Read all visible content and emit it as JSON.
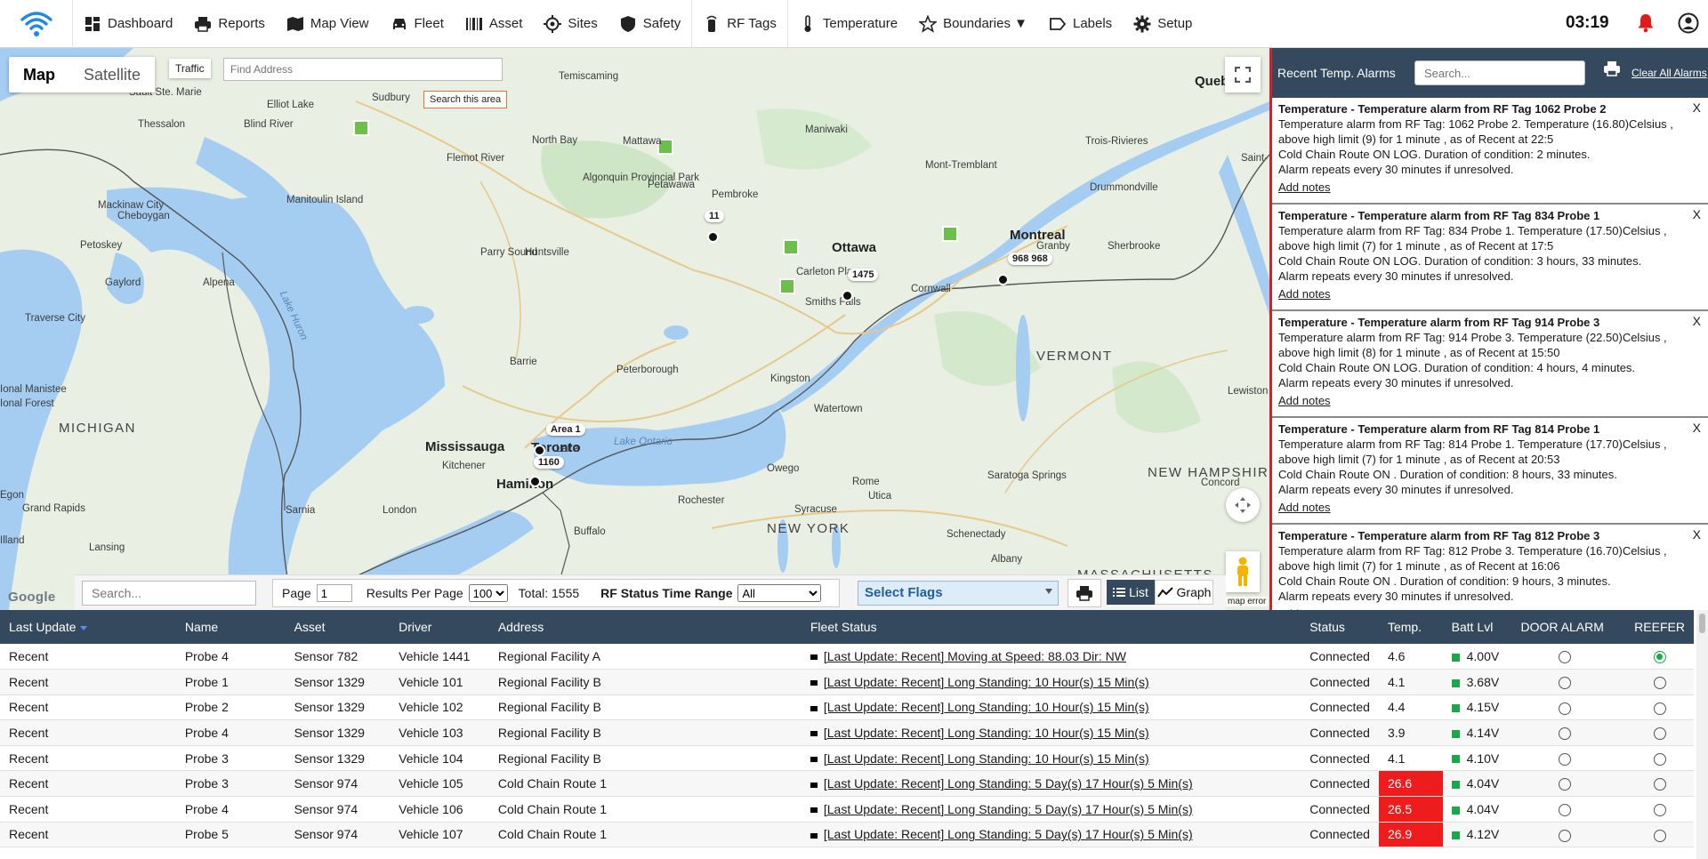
{
  "nav": {
    "items": [
      {
        "label": "Dashboard",
        "icon": "dashboard-icon"
      },
      {
        "label": "Reports",
        "icon": "printer-icon"
      },
      {
        "label": "Map View",
        "icon": "map-icon"
      },
      {
        "label": "Fleet",
        "icon": "car-icon"
      },
      {
        "label": "Asset",
        "icon": "barcode-icon"
      },
      {
        "label": "Sites",
        "icon": "crosshair-icon"
      },
      {
        "label": "Safety",
        "icon": "shield-icon"
      },
      {
        "label": "RF Tags",
        "icon": "rf-tag-icon"
      },
      {
        "label": "Temperature",
        "icon": "thermometer-icon"
      },
      {
        "label": "Boundaries ▼",
        "icon": "star-icon"
      },
      {
        "label": "Labels",
        "icon": "tag-icon"
      },
      {
        "label": "Setup",
        "icon": "gear-icon"
      }
    ],
    "time": "03:19"
  },
  "map": {
    "type_map": "Map",
    "type_satellite": "Satellite",
    "traffic": "Traffic",
    "find_placeholder": "Find Address",
    "search_area": "Search this area",
    "map_error": "map error",
    "google": "Google",
    "places": [
      {
        "name": "Temiscaming"
      },
      {
        "name": "Sault Ste. Marie"
      },
      {
        "name": "Elliot Lake"
      },
      {
        "name": "Sudbury"
      },
      {
        "name": "Thessalon"
      },
      {
        "name": "Blind River"
      },
      {
        "name": "North Bay"
      },
      {
        "name": "Mattawa"
      },
      {
        "name": "Maniwaki"
      },
      {
        "name": "Trois-Rivieres"
      },
      {
        "name": "Mont-Tremblant"
      },
      {
        "name": "Drummondville"
      },
      {
        "name": "Flemot River"
      },
      {
        "name": "Algonquin Provincial Park"
      },
      {
        "name": "Petawawa"
      },
      {
        "name": "Pembroke"
      },
      {
        "name": "Mackinaw City"
      },
      {
        "name": "Cheboygan"
      },
      {
        "name": "Manitoulin Island"
      },
      {
        "name": "Ottawa"
      },
      {
        "name": "Montreal"
      },
      {
        "name": "Granby"
      },
      {
        "name": "Sherbrooke"
      },
      {
        "name": "Petoskey"
      },
      {
        "name": "Parry Sound"
      },
      {
        "name": "Huntsville"
      },
      {
        "name": "Carleton Place"
      },
      {
        "name": "Cornwall"
      },
      {
        "name": "Gaylord"
      },
      {
        "name": "Alpena"
      },
      {
        "name": "Smiths Falls"
      },
      {
        "name": "Traverse City"
      },
      {
        "name": "Barrie"
      },
      {
        "name": "Peterborough"
      },
      {
        "name": "VERMONT"
      },
      {
        "name": "Kingston"
      },
      {
        "name": "Lewiston"
      },
      {
        "name": "MICHIGAN"
      },
      {
        "name": "Mississauga"
      },
      {
        "name": "Toronto"
      },
      {
        "name": "Watertown"
      },
      {
        "name": "Kitchener"
      },
      {
        "name": "Lake Ontario"
      },
      {
        "name": "Hamilton"
      },
      {
        "name": "Owego"
      },
      {
        "name": "NEW HAMPSHIRE"
      },
      {
        "name": "Concord"
      },
      {
        "name": "Rome"
      },
      {
        "name": "Utica"
      },
      {
        "name": "Rochester"
      },
      {
        "name": "Syracuse"
      },
      {
        "name": "Saratoga Springs"
      },
      {
        "name": "Grand Rapids"
      },
      {
        "name": "Sarnia"
      },
      {
        "name": "London"
      },
      {
        "name": "Buffalo"
      },
      {
        "name": "NEW YORK"
      },
      {
        "name": "Schenectady"
      },
      {
        "name": "Lansing"
      },
      {
        "name": "Albany"
      },
      {
        "name": "MASSACHUSETTS"
      },
      {
        "name": "Lake Huron"
      },
      {
        "name": "Queb"
      },
      {
        "name": "Saint-"
      },
      {
        "name": "Lake"
      },
      {
        "name": "Ional Manistee"
      },
      {
        "name": "Ional Forest"
      },
      {
        "name": "Illand"
      },
      {
        "name": "Egon"
      }
    ],
    "markers": [
      {
        "label": "11"
      },
      {
        "label": "1475"
      },
      {
        "label": "968 968"
      },
      {
        "label": "Area 1"
      },
      {
        "label": "1160"
      }
    ]
  },
  "filter": {
    "search_placeholder": "Search...",
    "page_label": "Page",
    "page_value": "1",
    "results_label": "Results Per Page",
    "results_value": "100",
    "total": "Total: 1555",
    "range_label": "RF Status Time Range",
    "range_value": "All",
    "flags": "Select Flags",
    "list": "List",
    "graph": "Graph"
  },
  "alarms": {
    "title": "Recent Temp. Alarms",
    "search_placeholder": "Search...",
    "clear": "Clear All Alarms",
    "add_notes": "Add notes",
    "items": [
      {
        "title": "Temperature - Temperature alarm from RF Tag 1062 Probe 2",
        "l1": "Temperature alarm from RF Tag: 1062 Probe 2. Temperature (16.80)Celsius ,",
        "l2": "above high limit (9) for 1 minute , as of Recent at 22:5",
        "l3": "Cold Chain Route ON LOG. Duration of condition: 2 minutes.",
        "l4": "Alarm repeats every 30 minutes if unresolved."
      },
      {
        "title": "Temperature - Temperature alarm from RF Tag 834 Probe 1",
        "l1": "Temperature alarm from RF Tag: 834 Probe 1. Temperature (17.50)Celsius ,",
        "l2": "above high limit (7) for 1 minute , as of Recent at 17:5",
        "l3": "Cold Chain Route ON LOG. Duration of condition: 3 hours, 33 minutes.",
        "l4": "Alarm repeats every 30 minutes if unresolved."
      },
      {
        "title": "Temperature - Temperature alarm from RF Tag 914 Probe 3",
        "l1": "Temperature alarm from RF Tag: 914 Probe 3. Temperature (22.50)Celsius ,",
        "l2": "above high limit (8) for 1 minute , as of Recent at 15:50",
        "l3": "Cold Chain Route ON LOG. Duration of condition: 4 hours, 4 minutes.",
        "l4": "Alarm repeats every 30 minutes if unresolved."
      },
      {
        "title": "Temperature - Temperature alarm from RF Tag 814 Probe 1",
        "l1": "Temperature alarm from RF Tag: 814 Probe 1. Temperature (17.70)Celsius ,",
        "l2": "above high limit (7) for 1 minute , as of Recent at 20:53",
        "l3": "Cold Chain Route ON . Duration of condition: 8 hours, 33 minutes.",
        "l4": "Alarm repeats every 30 minutes if unresolved."
      },
      {
        "title": "Temperature - Temperature alarm from RF Tag 812 Probe 3",
        "l1": "Temperature alarm from RF Tag: 812 Probe 3. Temperature (16.70)Celsius ,",
        "l2": "above high limit (7) for 1 minute , as of Recent at 16:06",
        "l3": "Cold Chain Route ON . Duration of condition: 9 hours, 3 minutes.",
        "l4": "Alarm repeats every 30 minutes if unresolved."
      }
    ]
  },
  "table": {
    "columns": [
      "Last Update",
      "Name",
      "Asset",
      "Driver",
      "Address",
      "Fleet Status",
      "Status",
      "Temp.",
      "Batt Lvl",
      "DOOR ALARM",
      "REEFER"
    ],
    "rows": [
      {
        "update": "Recent",
        "name": "Probe 4",
        "asset": "Sensor 782",
        "driver": "Vehicle 1441",
        "address": "Regional Facility A",
        "fleet_bracket": "[Last Update: Recent]",
        "fleet_text": " Moving at Speed: 88.03 Dir: NW",
        "status": "Connected",
        "temp": "4.6",
        "batt": "4.00V",
        "hot": false,
        "reefer": true
      },
      {
        "update": "Recent",
        "name": "Probe 1",
        "asset": "Sensor 1329",
        "driver": "Vehicle 101",
        "address": "Regional Facility B",
        "fleet_bracket": "[Last Update: Recent]",
        "fleet_text": " Long Standing: 10 Hour(s) 15 Min(s)",
        "status": "Connected",
        "temp": "4.1",
        "batt": "3.68V",
        "hot": false,
        "reefer": false
      },
      {
        "update": "Recent",
        "name": "Probe 2",
        "asset": "Sensor 1329",
        "driver": "Vehicle 102",
        "address": "Regional Facility B",
        "fleet_bracket": "[Last Update: Recent]",
        "fleet_text": " Long Standing: 10 Hour(s) 15 Min(s)",
        "status": "Connected",
        "temp": "4.4",
        "batt": "4.15V",
        "hot": false,
        "reefer": false
      },
      {
        "update": "Recent",
        "name": "Probe 4",
        "asset": "Sensor 1329",
        "driver": "Vehicle 103",
        "address": "Regional Facility B",
        "fleet_bracket": "[Last Update: Recent]",
        "fleet_text": " Long Standing: 10 Hour(s) 15 Min(s)",
        "status": "Connected",
        "temp": "3.9",
        "batt": "4.14V",
        "hot": false,
        "reefer": false
      },
      {
        "update": "Recent",
        "name": "Probe 3",
        "asset": "Sensor 1329",
        "driver": "Vehicle 104",
        "address": "Regional Facility B",
        "fleet_bracket": "[Last Update: Recent]",
        "fleet_text": " Long Standing: 10 Hour(s) 15 Min(s)",
        "status": "Connected",
        "temp": "4.1",
        "batt": "4.10V",
        "hot": false,
        "reefer": false
      },
      {
        "update": "Recent",
        "name": "Probe 3",
        "asset": "Sensor 974",
        "driver": "Vehicle 105",
        "address": "Cold Chain Route 1",
        "fleet_bracket": "[Last Update: Recent]",
        "fleet_text": " Long Standing: 5 Day(s) 17 Hour(s) 5 Min(s)",
        "status": "Connected",
        "temp": "26.6",
        "batt": "4.04V",
        "hot": true,
        "reefer": false
      },
      {
        "update": "Recent",
        "name": "Probe 4",
        "asset": "Sensor 974",
        "driver": "Vehicle 106",
        "address": "Cold Chain Route 1",
        "fleet_bracket": "[Last Update: Recent]",
        "fleet_text": " Long Standing: 5 Day(s) 17 Hour(s) 5 Min(s)",
        "status": "Connected",
        "temp": "26.5",
        "batt": "4.04V",
        "hot": true,
        "reefer": false
      },
      {
        "update": "Recent",
        "name": "Probe 5",
        "asset": "Sensor 974",
        "driver": "Vehicle 107",
        "address": "Cold Chain Route 1",
        "fleet_bracket": "[Last Update: Recent]",
        "fleet_text": " Long Standing: 5 Day(s) 17 Hour(s) 5 Min(s)",
        "status": "Connected",
        "temp": "26.9",
        "batt": "4.12V",
        "hot": true,
        "reefer": false
      }
    ]
  },
  "colors": {
    "header": "#34495e",
    "alarm_red": "#ee1c1c",
    "ok_green": "#1aa84a",
    "water": "#a5cdf2",
    "land": "#e9efe3",
    "park": "#cfe6c6"
  }
}
